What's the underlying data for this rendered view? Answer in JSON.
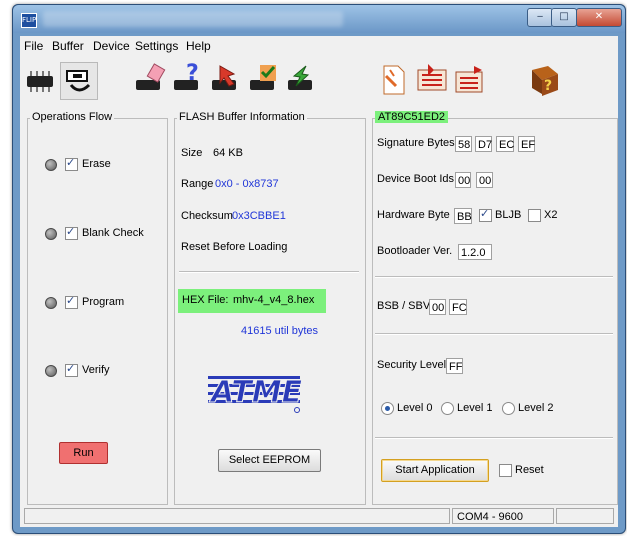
{
  "window": {
    "app_icon_text": "FLIP",
    "buttons": {
      "minimize": "‒",
      "maximize": "□",
      "close": "✕"
    }
  },
  "menu": [
    "File",
    "Buffer",
    "Device",
    "Settings",
    "Help"
  ],
  "toolbar": [
    "select-device-icon",
    "communication-icon",
    "erase-icon",
    "blank-check-icon",
    "program-icon",
    "verify-icon",
    "read-icon",
    "load-hex-icon",
    "save-buffer-icon",
    "edit-buffer-icon",
    "help-icon"
  ],
  "ops": {
    "title": "Operations Flow",
    "items": [
      {
        "label": "Erase",
        "checked": true
      },
      {
        "label": "Blank Check",
        "checked": true
      },
      {
        "label": "Program",
        "checked": true
      },
      {
        "label": "Verify",
        "checked": true
      }
    ],
    "run": "Run"
  },
  "flash": {
    "title": "FLASH Buffer Information",
    "size_label": "Size",
    "size_value": "64 KB",
    "range_label": "Range",
    "range_value": "0x0 - 0x8737",
    "checksum_label": "Checksum",
    "checksum_value": "0x3CBBE1",
    "reset_label": "Reset Before Loading",
    "hex_label": "HEX File:",
    "hex_value": "mhv-4_v4_8.hex",
    "bytes": "41615 util bytes",
    "logo": "ATMEL",
    "select_eeprom": "Select EEPROM"
  },
  "device": {
    "title": "AT89C51ED2",
    "sig_label": "Signature Bytes",
    "sig": [
      "58",
      "D7",
      "EC",
      "EF"
    ],
    "boot_label": "Device Boot Ids",
    "boot": [
      "00",
      "00"
    ],
    "hw_label": "Hardware Byte",
    "hw_value": "BB",
    "bljb": "BLJB",
    "x2": "X2",
    "bl_label": "Bootloader Ver.",
    "bl_value": "1.2.0",
    "bsb_label": "BSB / SBV",
    "bsb": [
      "00",
      "FC"
    ],
    "sec_label": "Security Level",
    "sec_value": "FF",
    "levels": [
      "Level 0",
      "Level 1",
      "Level 2"
    ],
    "start": "Start Application",
    "reset": "Reset"
  },
  "status": {
    "left": "",
    "port": "COM4 - 9600",
    "right": ""
  },
  "colors": {
    "highlight_green": "#7cf07c",
    "value_blue": "#2036d8",
    "run_red": "#f07070"
  }
}
